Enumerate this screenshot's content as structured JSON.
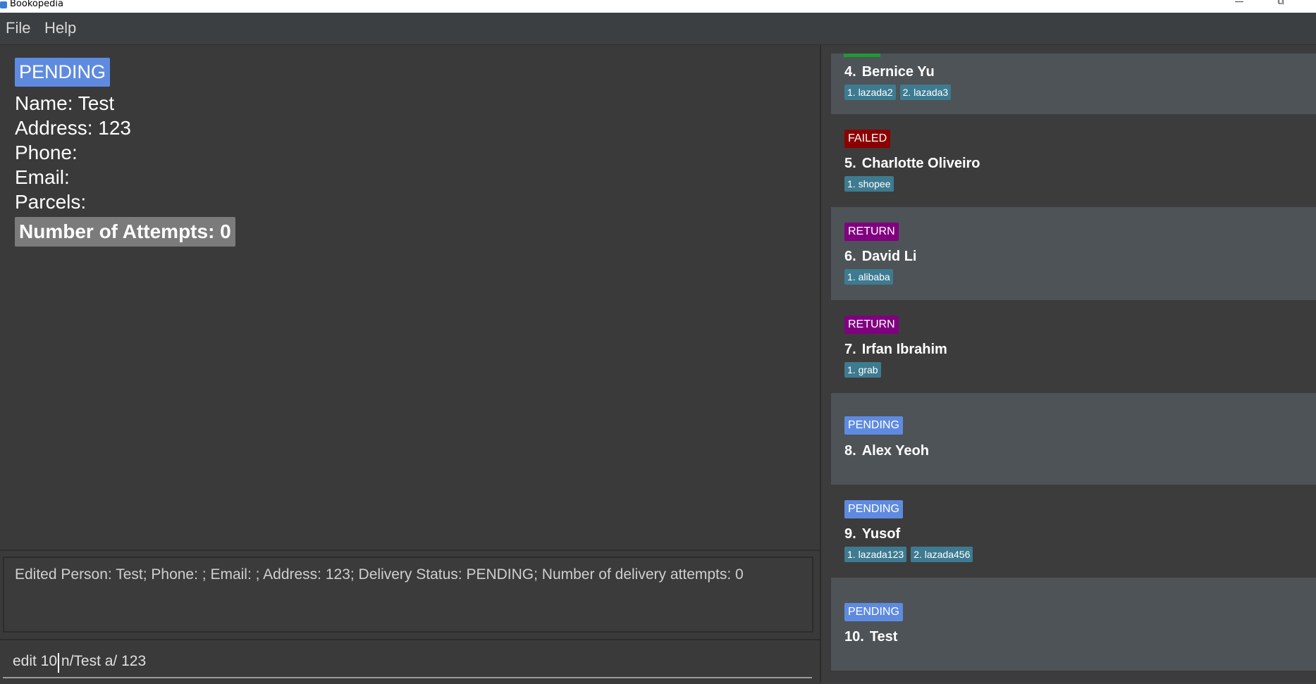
{
  "window": {
    "title": "Bookopedia",
    "minimize_glyph": "—",
    "restore_glyph": "⧉"
  },
  "menu": {
    "file": "File",
    "help": "Help"
  },
  "detail": {
    "status": "PENDING",
    "name": "Name: Test",
    "address": "Address: 123",
    "phone": "Phone:",
    "email": "Email:",
    "parcels": "Parcels:",
    "attempts": "Number of Attempts: 0"
  },
  "colors": {
    "PENDING": "#5e8be0",
    "FAILED": "#8b0000",
    "RETURN": "#800080",
    "DELIVERED": "#1f9a33"
  },
  "result": "Edited Person: Test; Phone: ; Email: ; Address: 123; Delivery Status: PENDING; Number of delivery attempts: 0",
  "command": "edit 10 n/Test a/ 123",
  "persons": [
    {
      "index": "4.",
      "name": "Bernice Yu",
      "status": "",
      "tags": [
        "1. lazada2",
        "2. lazada3"
      ]
    },
    {
      "index": "5.",
      "name": "Charlotte Oliveiro",
      "status": "FAILED",
      "tags": [
        "1. shopee"
      ]
    },
    {
      "index": "6.",
      "name": "David Li",
      "status": "RETURN",
      "tags": [
        "1. alibaba"
      ]
    },
    {
      "index": "7.",
      "name": "Irfan Ibrahim",
      "status": "RETURN",
      "tags": [
        "1. grab"
      ]
    },
    {
      "index": "8.",
      "name": "Alex Yeoh",
      "status": "PENDING",
      "tags": []
    },
    {
      "index": "9.",
      "name": "Yusof",
      "status": "PENDING",
      "tags": [
        "1. lazada123",
        "2. lazada456"
      ]
    },
    {
      "index": "10.",
      "name": "Test",
      "status": "PENDING",
      "tags": []
    }
  ]
}
